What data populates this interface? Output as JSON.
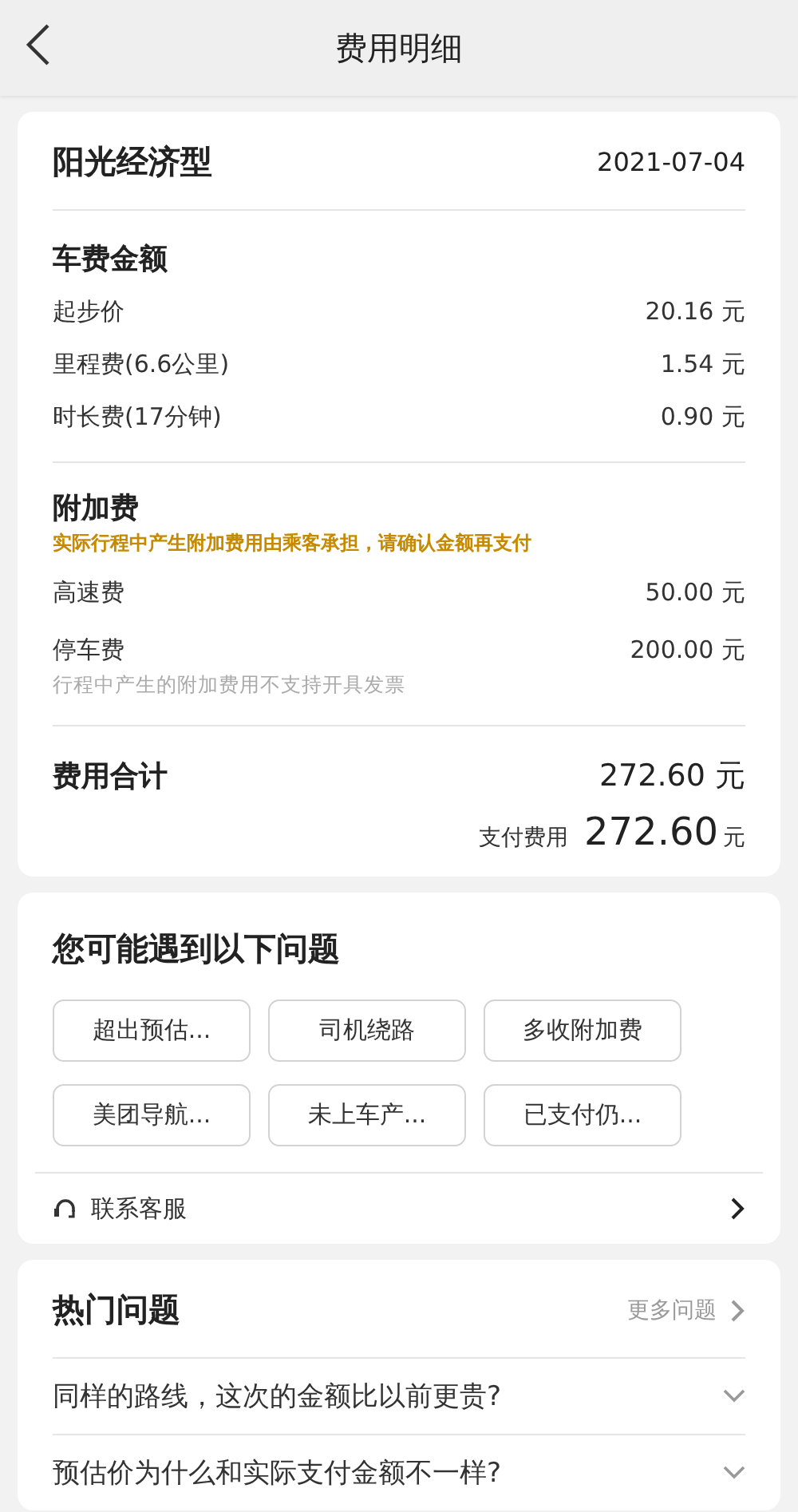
{
  "header": {
    "title": "费用明细"
  },
  "fare": {
    "car_type": "阳光经济型",
    "date": "2021-07-04",
    "base_section": {
      "title": "车费金额",
      "items": [
        {
          "label": "起步价",
          "amount": "20.16 元"
        },
        {
          "label": "里程费(6.6公里)",
          "amount": "1.54 元"
        },
        {
          "label": "时长费(17分钟)",
          "amount": "0.90 元"
        }
      ]
    },
    "extra_section": {
      "title": "附加费",
      "warning": "实际行程中产生附加费用由乘客承担，请确认金额再支付",
      "items": [
        {
          "label": "高速费",
          "amount": "50.00 元"
        },
        {
          "label": "停车费",
          "amount": "200.00 元"
        }
      ],
      "note": "行程中产生的附加费用不支持开具发票"
    },
    "total": {
      "label": "费用合计",
      "amount": "272.60 元",
      "paid_label": "支付费用",
      "paid_amount": "272.60",
      "paid_unit": "元"
    }
  },
  "issues": {
    "title": "您可能遇到以下问题",
    "options": [
      "超出预估...",
      "司机绕路",
      "多收附加费",
      "美团导航...",
      "未上车产...",
      "已支付仍..."
    ],
    "contact": "联系客服"
  },
  "faq": {
    "title": "热门问题",
    "more": "更多问题",
    "questions": [
      {
        "text": "同样的路线，这次的金额比以前更贵?",
        "expanded": false
      },
      {
        "text": "预估价为什么和实际支付金额不一样?",
        "expanded": false
      }
    ]
  }
}
